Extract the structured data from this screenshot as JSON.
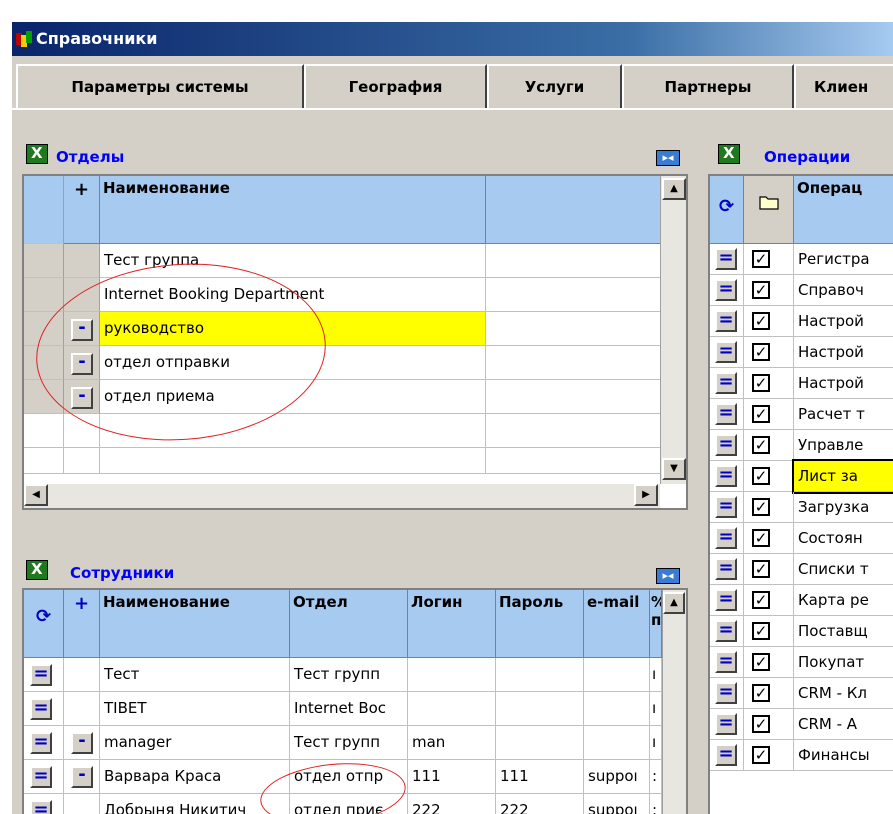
{
  "window": {
    "title": "Справочники"
  },
  "tabs": [
    "Параметры системы",
    "География",
    "Услуги",
    "Партнеры",
    "Клиен"
  ],
  "departments": {
    "title": "Отделы",
    "add_symbol": "+",
    "column_name": "Наименование",
    "rows": [
      "Тест группа",
      "Internet Booking Department",
      "руководство",
      "отдел отправки",
      "отдел приема"
    ],
    "minus_symbol": "-"
  },
  "employees": {
    "title": "Сотрудники",
    "add_symbol": "+",
    "columns": [
      "Наименование",
      "Отдел",
      "Логин",
      "Пароль",
      "e-mail",
      "%"
    ],
    "column_extra": "п",
    "rows": [
      {
        "name": "Тест",
        "dept": "Тест групп",
        "login": "",
        "password": "",
        "email": "",
        "pct": "ı"
      },
      {
        "name": "TIBET",
        "dept": "Internet Boc",
        "login": "",
        "password": "",
        "email": "",
        "pct": "ı"
      },
      {
        "name": "manager",
        "dept": "Тест групп",
        "login": "man",
        "password": "",
        "email": "",
        "pct": "ı"
      },
      {
        "name": "Варвара Краса",
        "dept": "отдел отпр",
        "login": "111",
        "password": "111",
        "email": "suppoı",
        "pct": ":"
      },
      {
        "name": "Добрыня Никитич",
        "dept": "отдел приє",
        "login": "222",
        "password": "222",
        "email": "suppoı",
        "pct": ":"
      }
    ],
    "eq_symbol": "=",
    "minus_symbol": "-"
  },
  "operations": {
    "title": "Операции",
    "column_name": "Операц",
    "eq_symbol": "=",
    "check_symbol": "✓",
    "rows": [
      "Регистра",
      "Справоч",
      "Настрой",
      "Настрой",
      "Настрой",
      "Расчет т",
      "Управле",
      "Лист за",
      "Загрузка",
      "Состоян",
      "Списки т",
      "Карта ре",
      "Поставщ",
      "Покупат",
      "CRM - Кл",
      "CRM - А",
      "Финансы"
    ]
  },
  "icons": {
    "title": "app-icon",
    "excel": "excel-export-icon",
    "expand": "expand-icon",
    "refresh": "refresh-icon",
    "folder": "folder-icon"
  },
  "colors": {
    "title_bar": "#0a246a",
    "header_bg": "#a6caf0",
    "highlight": "#ffff00",
    "panel_title": "#0000ff",
    "annotation": "#e02020"
  }
}
